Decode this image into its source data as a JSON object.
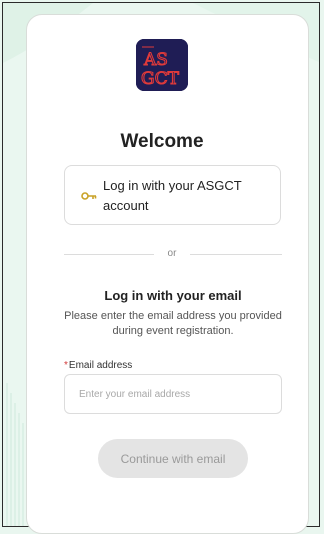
{
  "brand": {
    "logo_text_top": "AS",
    "logo_text_bottom": "GCT",
    "logo_bg": "#1f1d55",
    "logo_accent": "#e03a3a"
  },
  "heading": "Welcome",
  "sso": {
    "label": "Log in with your ASGCT account",
    "icon": "key-icon",
    "icon_color": "#c9a227"
  },
  "divider": {
    "text": "or"
  },
  "email_login": {
    "title": "Log in with your email",
    "description": "Please enter the email address you provided during event registration.",
    "field_label": "Email address",
    "required_mark": "*",
    "placeholder": "Enter your email address",
    "value": ""
  },
  "continue_label": "Continue with email",
  "colors": {
    "background": "#eaf7f0",
    "card": "#ffffff",
    "disabled_button": "#e4e4e4",
    "required": "#d23a3a"
  }
}
